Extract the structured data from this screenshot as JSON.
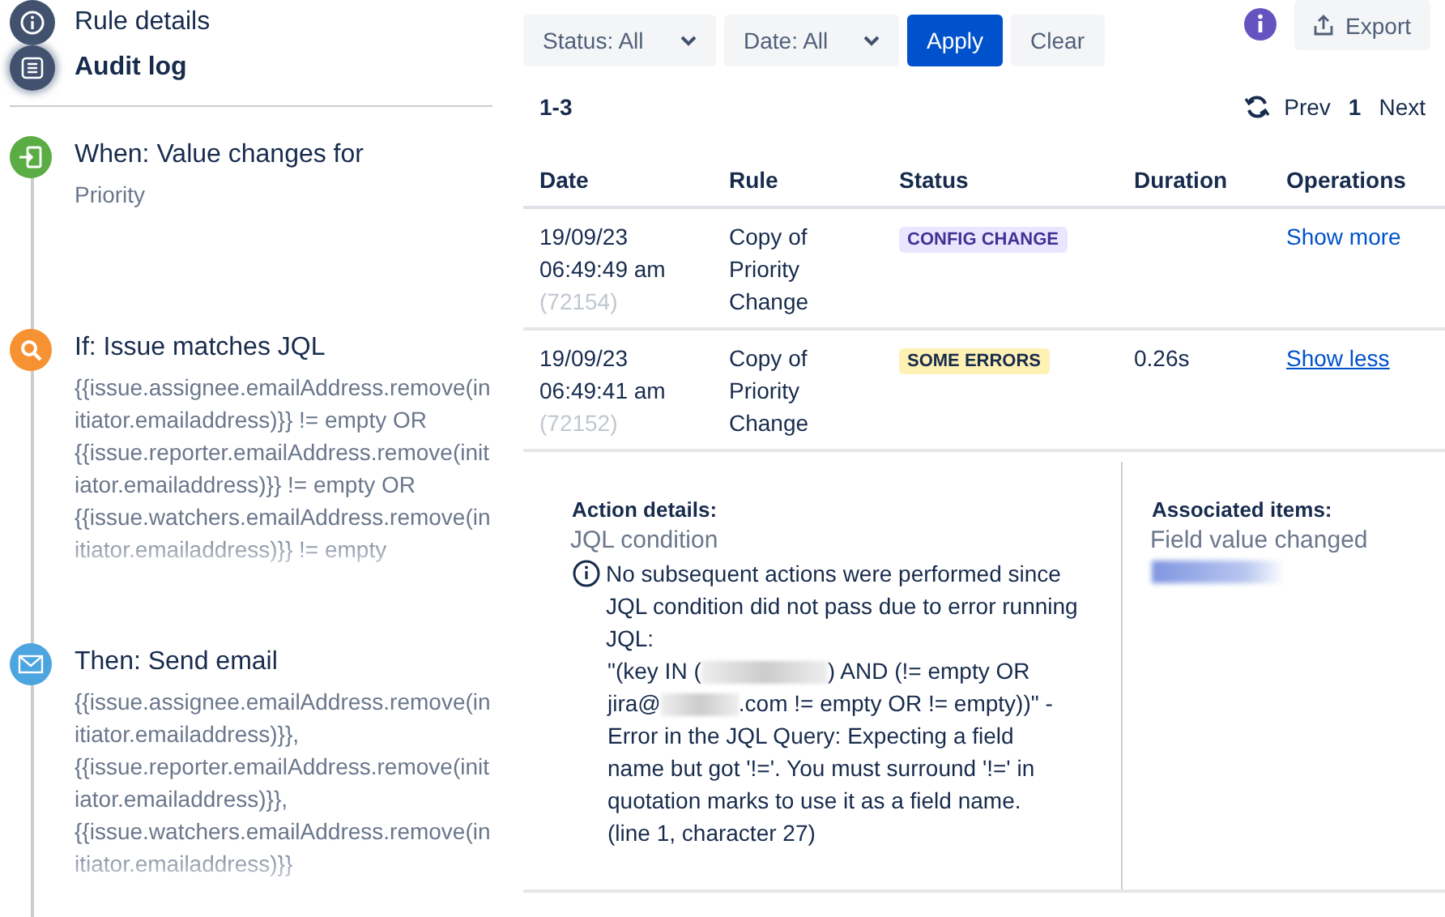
{
  "nav": [
    {
      "label": "Rule details",
      "kind": "info",
      "selected": false
    },
    {
      "label": "Audit log",
      "kind": "list",
      "selected": true
    }
  ],
  "steps": [
    {
      "kind": "trigger",
      "title": "When: Value changes for",
      "detail": "Priority"
    },
    {
      "kind": "condition",
      "title": "If: Issue matches JQL",
      "detail": "{{issue.assignee.emailAddress.remove(initiator.emailaddress)}} != empty OR {{issue.reporter.emailAddress.remove(initiator.emailaddress)}} != empty OR {{issue.watchers.emailAddress.remove(initiator.emailaddress)}} != empty"
    },
    {
      "kind": "action",
      "title": "Then: Send email",
      "detail": "{{issue.assignee.emailAddress.remove(initiator.emailaddress)}}, {{issue.reporter.emailAddress.remove(initiator.emailaddress)}}, {{issue.watchers.emailAddress.remove(initiator.emailaddress)}}"
    }
  ],
  "filters": [
    {
      "label": "Status: All"
    },
    {
      "label": "Date: All"
    }
  ],
  "apply": "Apply",
  "clear": "Clear",
  "export": "Export",
  "range": "1-3",
  "pager": {
    "prev": "Prev",
    "page": "1",
    "next": "Next"
  },
  "table": {
    "columns": [
      "Date",
      "Rule",
      "Status",
      "Duration",
      "Operations"
    ],
    "rows": [
      {
        "date": "19/09/23",
        "time": "06:49:49 am",
        "id": "(72154)",
        "rule": "Copy of Priority Change",
        "status": "CONFIG CHANGE",
        "kind": "config",
        "duration": "",
        "operation": "Show more",
        "expanded": false
      },
      {
        "date": "19/09/23",
        "time": "06:49:41 am",
        "id": "(72152)",
        "rule": "Copy of Priority Change",
        "status": "SOME ERRORS",
        "kind": "error",
        "duration": "0.26s",
        "operation": "Show less",
        "expanded": true
      }
    ]
  },
  "details": {
    "heading": "Action details:",
    "action": "JQL condition",
    "message": "No subsequent actions were performed since JQL condition did not pass due to error running JQL:",
    "error": [
      {
        "kind": "text",
        "text": "\"(key IN ("
      },
      {
        "kind": "redacted"
      },
      {
        "kind": "text",
        "text": ") AND (!= empty OR jira@"
      },
      {
        "kind": "redacted"
      },
      {
        "kind": "text",
        "text": ".com != empty OR != empty))\" - Error in the JQL Query: Expecting a field name but got '!='. You must surround '!=' in quotation marks to use it as a field name. (line 1, character 27)"
      }
    ],
    "associated_heading": "Associated items:",
    "associated": "Field value changed"
  }
}
